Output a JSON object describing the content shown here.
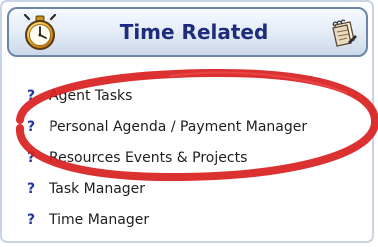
{
  "header": {
    "title": "Time Related",
    "left_icon": "stopwatch-icon",
    "right_icon": "notepad-icon"
  },
  "menu": {
    "item_icon": "help-icon",
    "items": [
      {
        "icon_text": "?",
        "label": "Agent Tasks"
      },
      {
        "icon_text": "?",
        "label": "Personal Agenda / Payment Manager"
      },
      {
        "icon_text": "?",
        "label": "Resources Events & Projects"
      },
      {
        "icon_text": "?",
        "label": "Task Manager"
      },
      {
        "icon_text": "?",
        "label": "Time Manager"
      }
    ]
  },
  "colors": {
    "header_text": "#1d2c7d",
    "header_border": "#6d86a6",
    "help_icon": "#2433a6",
    "annotation_ellipse": "#d91f1f"
  }
}
